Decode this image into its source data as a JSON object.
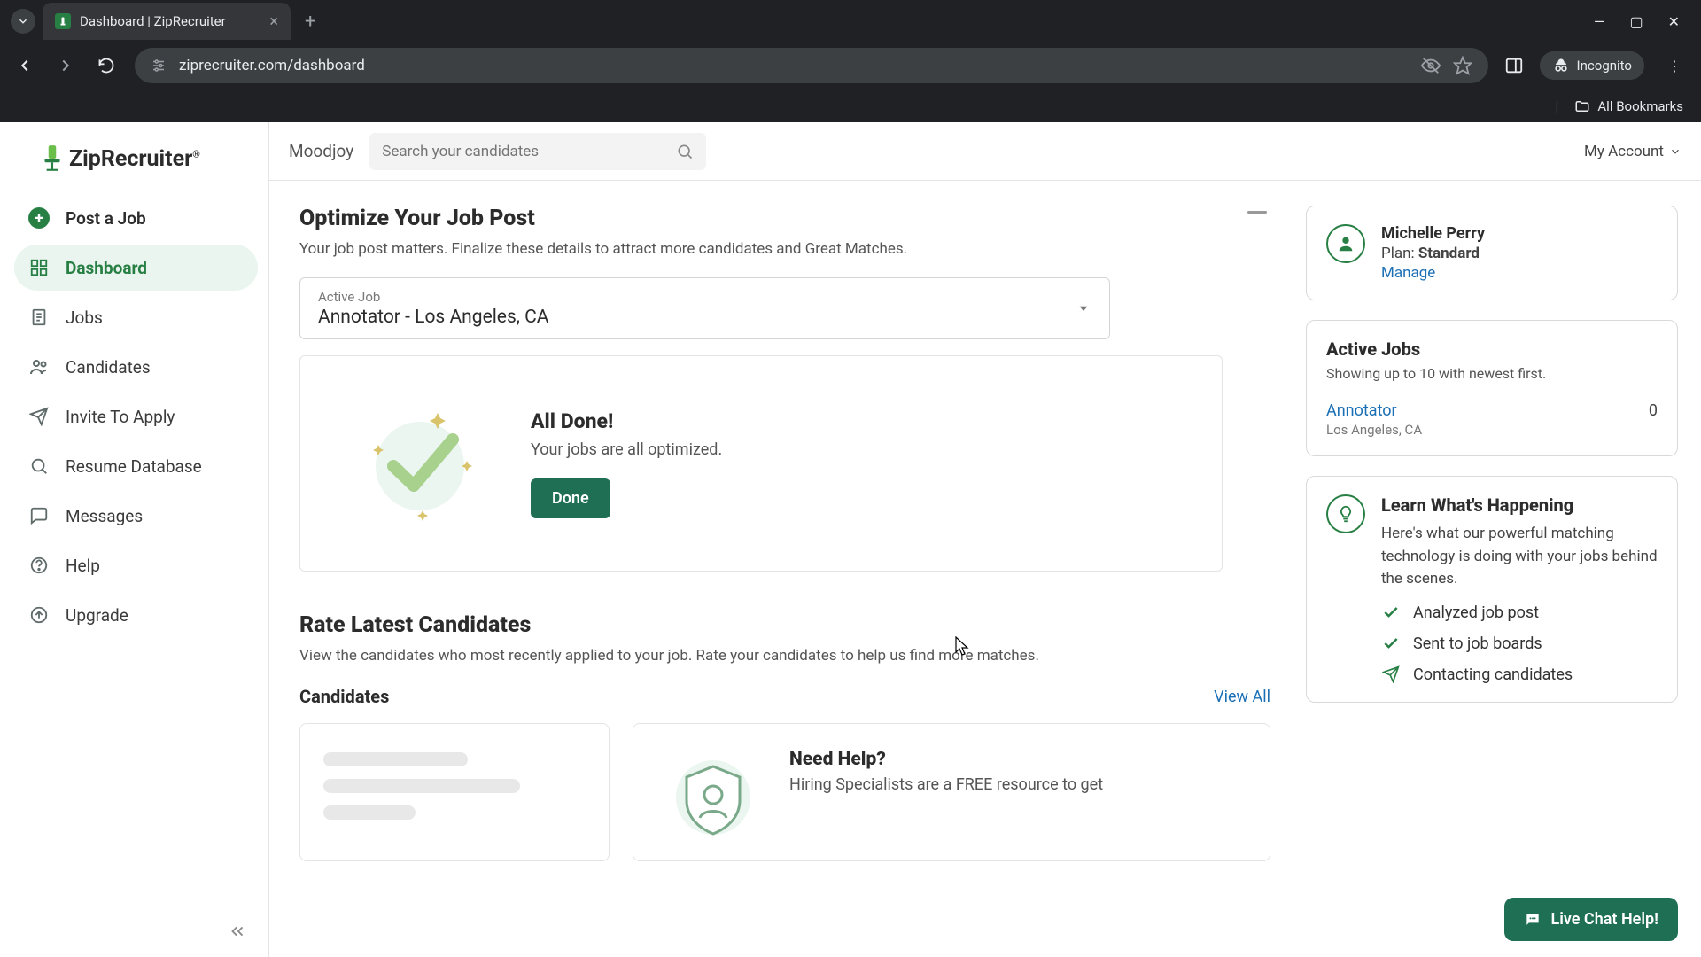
{
  "browser": {
    "tab_title": "Dashboard | ZipRecruiter",
    "url": "ziprecruiter.com/dashboard",
    "incognito_label": "Incognito",
    "all_bookmarks": "All Bookmarks"
  },
  "brand": {
    "name": "ZipRecruiter",
    "accent": "#277f44"
  },
  "sidebar": {
    "items": [
      {
        "label": "Post a Job"
      },
      {
        "label": "Dashboard"
      },
      {
        "label": "Jobs"
      },
      {
        "label": "Candidates"
      },
      {
        "label": "Invite To Apply"
      },
      {
        "label": "Resume Database"
      },
      {
        "label": "Messages"
      },
      {
        "label": "Help"
      },
      {
        "label": "Upgrade"
      }
    ]
  },
  "topbar": {
    "org": "Moodjoy",
    "search_placeholder": "Search your candidates",
    "account_label": "My Account"
  },
  "optimize": {
    "title": "Optimize Your Job Post",
    "subtitle": "Your job post matters. Finalize these details to attract more candidates and Great Matches.",
    "select_label": "Active Job",
    "select_value": "Annotator - Los Angeles, CA",
    "done_title": "All Done!",
    "done_body": "Your jobs are all optimized.",
    "done_button": "Done"
  },
  "rate": {
    "title": "Rate Latest Candidates",
    "subtitle": "View the candidates who most recently applied to your job. Rate your candidates to help us find more matches.",
    "candidates_label": "Candidates",
    "view_all": "View All"
  },
  "help_card": {
    "title": "Need Help?",
    "body": "Hiring Specialists are a FREE resource to get"
  },
  "user_card": {
    "name": "Michelle Perry",
    "plan_prefix": "Plan: ",
    "plan_value": "Standard",
    "manage": "Manage"
  },
  "active_jobs": {
    "title": "Active Jobs",
    "subtitle": "Showing up to 10 with newest first.",
    "items": [
      {
        "name": "Annotator",
        "location": "Los Angeles, CA",
        "count": "0"
      }
    ]
  },
  "learn": {
    "title": "Learn What's Happening",
    "body": "Here's what our powerful matching technology is doing with your jobs behind the scenes.",
    "steps": [
      {
        "label": "Analyzed job post",
        "state": "done"
      },
      {
        "label": "Sent to job boards",
        "state": "done"
      },
      {
        "label": "Contacting candidates",
        "state": "progress"
      }
    ]
  },
  "chat": {
    "label": "Live Chat Help!"
  }
}
